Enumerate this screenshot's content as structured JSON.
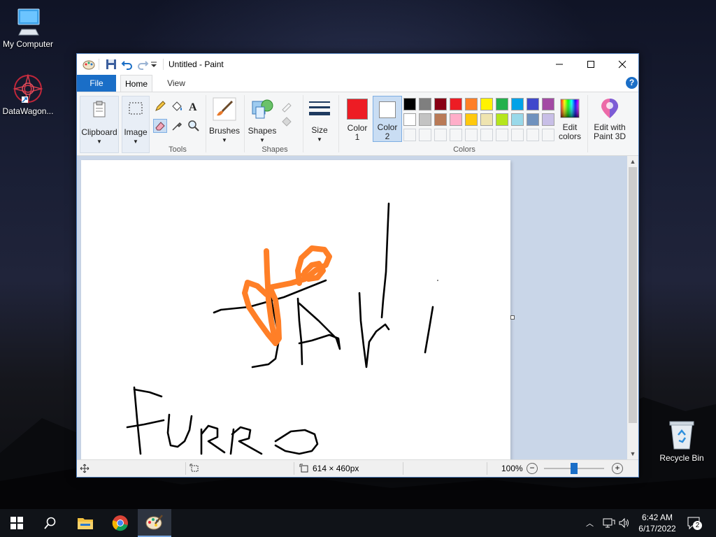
{
  "desktop": {
    "icons": [
      {
        "label": "My Computer"
      },
      {
        "label": "DataWagon..."
      },
      {
        "label": "Recycle Bin"
      }
    ]
  },
  "window": {
    "title": "Untitled - Paint",
    "tabs": [
      "File",
      "Home",
      "View"
    ]
  },
  "ribbon": {
    "clipboard": "Clipboard",
    "image": "Image",
    "tools_group": "Tools",
    "brushes": "Brushes",
    "shapes": "Shapes",
    "shapes_group": "Shapes",
    "size": "Size",
    "color1": [
      "Color",
      "1"
    ],
    "color2": [
      "Color",
      "2"
    ],
    "colors_group": "Colors",
    "edit_colors": [
      "Edit",
      "colors"
    ],
    "paint3d": [
      "Edit with",
      "Paint 3D"
    ],
    "color1_value": "#ed1c24",
    "color2_value": "#ffffff",
    "palette_row1": [
      "#000000",
      "#7f7f7f",
      "#880015",
      "#ed1c24",
      "#ff7f27",
      "#fff200",
      "#22b14c",
      "#00a2e8",
      "#3f48cc",
      "#a349a4"
    ],
    "palette_row2": [
      "#ffffff",
      "#c3c3c3",
      "#b97a57",
      "#ffaec9",
      "#ffc90e",
      "#efe4b0",
      "#b5e61d",
      "#99d9ea",
      "#7092be",
      "#c8bfe7"
    ],
    "palette_row3": [
      "#f5f6f7",
      "#f5f6f7",
      "#f5f6f7",
      "#f5f6f7",
      "#f5f6f7",
      "#f5f6f7",
      "#f5f6f7",
      "#f5f6f7",
      "#f5f6f7",
      "#f5f6f7"
    ]
  },
  "status": {
    "canvas_size": "614 × 460px",
    "zoom": "100%",
    "zoom_level": 0.5
  },
  "taskbar": {
    "time": "6:42 AM",
    "date": "6/17/2022",
    "notifications": "2"
  }
}
